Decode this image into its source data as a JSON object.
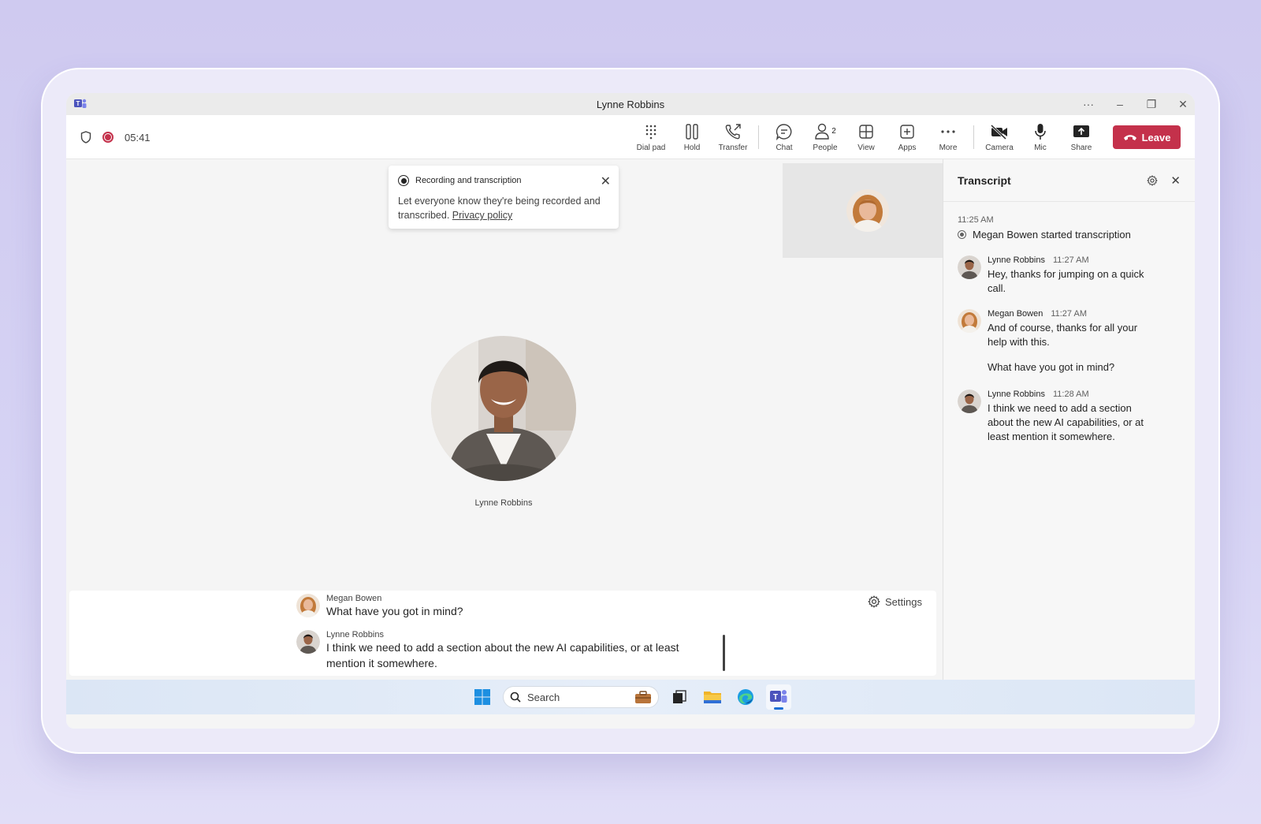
{
  "window": {
    "title": "Lynne Robbins"
  },
  "toolbar": {
    "timer": "05:41",
    "buttons": [
      {
        "label": "Dial pad",
        "icon": "dialpad-icon"
      },
      {
        "label": "Hold",
        "icon": "pause-icon"
      },
      {
        "label": "Transfer",
        "icon": "transfer-icon"
      },
      {
        "label": "Chat",
        "icon": "chat-icon"
      },
      {
        "label": "People",
        "icon": "people-icon",
        "badge": "2"
      },
      {
        "label": "View",
        "icon": "view-icon"
      },
      {
        "label": "Apps",
        "icon": "apps-icon"
      },
      {
        "label": "More",
        "icon": "more-icon"
      },
      {
        "label": "Camera",
        "icon": "camera-off-icon"
      },
      {
        "label": "Mic",
        "icon": "mic-icon"
      },
      {
        "label": "Share",
        "icon": "share-icon"
      }
    ],
    "leave_label": "Leave"
  },
  "toast": {
    "title": "Recording and transcription",
    "body": "Let everyone know they're being recorded and transcribed.",
    "link": "Privacy policy"
  },
  "stage": {
    "participant_name": "Lynne Robbins"
  },
  "captions": {
    "settings_label": "Settings",
    "items": [
      {
        "name": "Megan Bowen",
        "text": "What have you got in mind?"
      },
      {
        "name": "Lynne Robbins",
        "text": "I think we need to add a section about the new AI capabilities, or at least mention it somewhere."
      }
    ]
  },
  "transcript": {
    "title": "Transcript",
    "start_time": "11:25 AM",
    "start_event": "Megan Bowen started transcription",
    "entries": [
      {
        "name": "Lynne Robbins",
        "time": "11:27 AM",
        "text": "Hey, thanks for jumping on a quick call."
      },
      {
        "name": "Megan Bowen",
        "time": "11:27 AM",
        "text": "And of course, thanks for all your help with this."
      },
      {
        "name": "Lynne Robbins",
        "time": "11:28 AM",
        "text": "I think we need to add a section about the new AI capabilities, or at least mention it somewhere."
      }
    ],
    "extra_line": "What have you got in mind?"
  },
  "taskbar": {
    "search_placeholder": "Search"
  },
  "colors": {
    "leave": "#c4314b",
    "recording": "#c4314b",
    "accent": "#5b5fc7"
  }
}
